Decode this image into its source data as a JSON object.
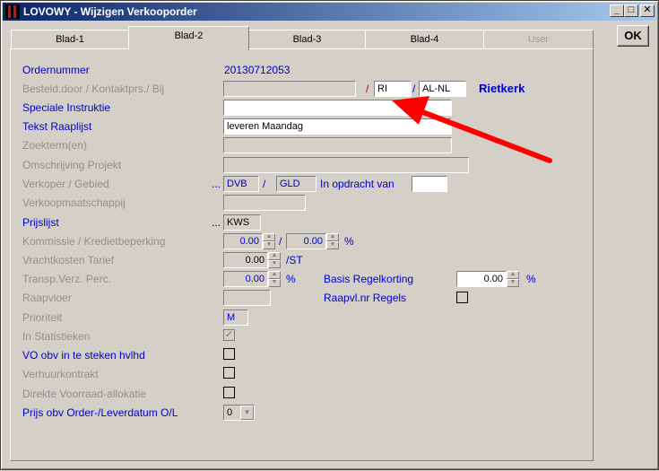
{
  "window": {
    "title": "LOVOWY - Wijzigen Verkooporder",
    "minimize": "_",
    "maximize": "□",
    "close": "✕",
    "ok_label": "OK"
  },
  "tabs": [
    "Blad-1",
    "Blad-2",
    "Blad-3",
    "Blad-4",
    "User"
  ],
  "form": {
    "ordernummer_label": "Ordernummer",
    "ordernummer_value": "20130712053",
    "besteld_label": "Besteld.door / Kontaktprs./ Bij",
    "besteld_value": "",
    "slash": "/",
    "kontakt_value": "RI",
    "bij_value": "AL-NL",
    "customer_name": "Rietkerk",
    "speciale_label": "Speciale Instruktie",
    "speciale_value": "",
    "raaplijst_label": "Tekst Raaplijst",
    "raaplijst_value": "leveren Maandag",
    "zoekterm_label": "Zoekterm(en)",
    "omschrijving_label": "Omschrijving Projekt",
    "verkoper_label": "Verkoper / Gebied",
    "ellipsis": "...",
    "verkoper_value": "DVB",
    "gebied_value": "GLD",
    "opdracht_label": "In opdracht van",
    "opdracht_value": "",
    "verkoopmij_label": "Verkoopmaatschappij",
    "prijslijst_label": "Prijslijst",
    "prijslijst_value": "KWS",
    "kommissie_label": "Kommissie / Kredietbeperking",
    "kommissie_value": "0.00",
    "krediet_value": "0.00",
    "percent": "%",
    "vracht_label": "Vrachtkosten Tarief",
    "vracht_value": "0.00",
    "vracht_unit": "/ST",
    "transp_label": "Transp.Verz. Perc.",
    "transp_value": "0.00",
    "basis_label": "Basis Regelkorting",
    "basis_value": "0.00",
    "raapvloer_label": "Raapvloer",
    "raapvl_regels_label": "Raapvl.nr Regels",
    "prioriteit_label": "Prioriteit",
    "prioriteit_value": "M",
    "statistieken_label": "In Statistieken",
    "vo_obv_label": "VO obv in te steken hvlhd",
    "verhuur_label": "Verhuurkontrakt",
    "direkte_label": "Direkte Voorraad-allokatie",
    "prijs_obv_label": "Prijs obv Order-/Leverdatum O/L",
    "prijs_obv_value": "0"
  },
  "colors": {
    "accent_blue": "#0000cc",
    "annotation_red": "#ff0000",
    "title_blue": "#0a246a"
  }
}
